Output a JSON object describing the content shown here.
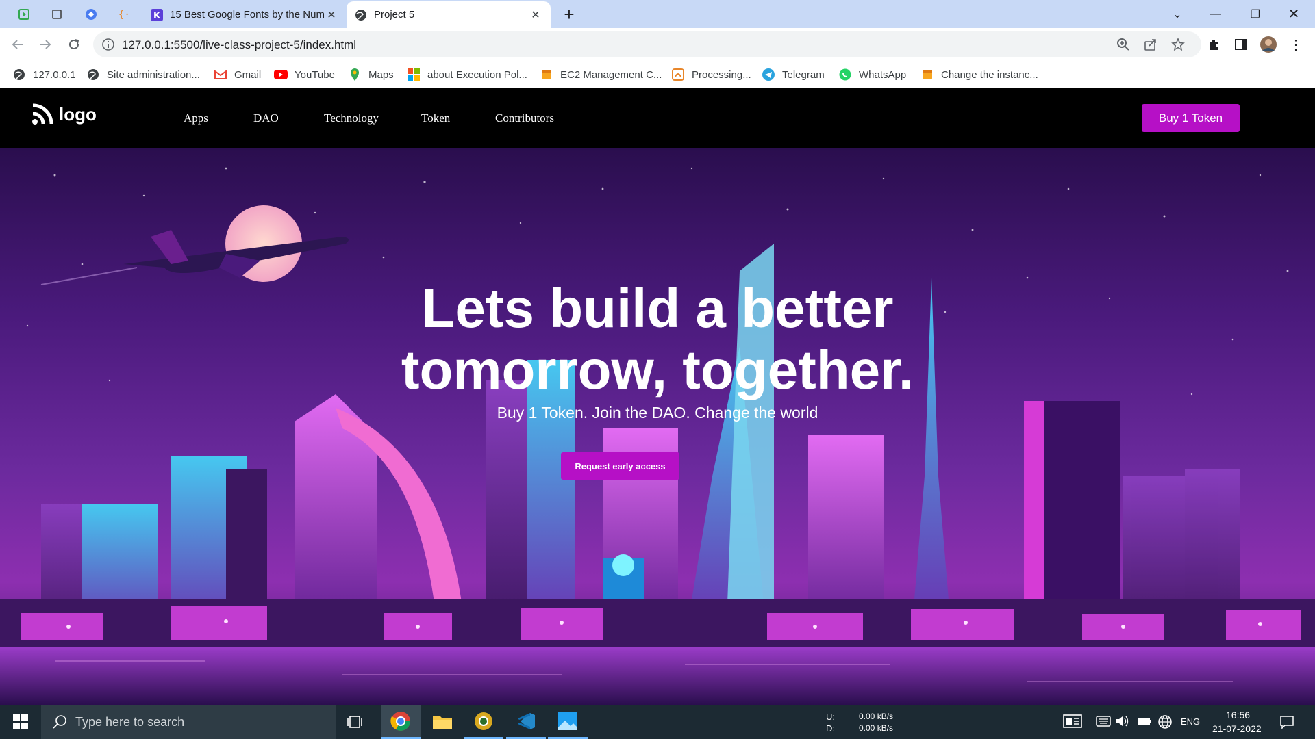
{
  "browser": {
    "tabs": [
      {
        "title": "15 Best Google Fonts by the Num",
        "favicon": "k-letter-icon",
        "active": false
      },
      {
        "title": "Project 5",
        "favicon": "globe-icon",
        "active": true
      }
    ],
    "new_tab": "+",
    "url": "127.0.0.1:5500/live-class-project-5/index.html",
    "bookmarks": [
      {
        "label": "127.0.0.1",
        "icon": "globe-icon"
      },
      {
        "label": "Site administration...",
        "icon": "globe-icon"
      },
      {
        "label": "Gmail",
        "icon": "gmail-icon"
      },
      {
        "label": "YouTube",
        "icon": "youtube-icon"
      },
      {
        "label": "Maps",
        "icon": "maps-icon"
      },
      {
        "label": "about Execution Pol...",
        "icon": "microsoft-icon"
      },
      {
        "label": "EC2 Management C...",
        "icon": "aws-icon"
      },
      {
        "label": "Processing...",
        "icon": "processing-icon"
      },
      {
        "label": "Telegram",
        "icon": "telegram-icon"
      },
      {
        "label": "WhatsApp",
        "icon": "whatsapp-icon"
      },
      {
        "label": "Change the instanc...",
        "icon": "aws-icon"
      }
    ]
  },
  "site": {
    "logo_text": "logo",
    "nav": [
      "Apps",
      "DAO",
      "Technology",
      "Token",
      "Contributors"
    ],
    "buy_button": "Buy 1 Token",
    "hero": {
      "title": "Lets build a better tomorrow, together.",
      "subtitle": "Buy 1 Token. Join the DAO. Change the world",
      "cta": "Request early access"
    },
    "accent_color": "#b610c6"
  },
  "taskbar": {
    "search_placeholder": "Type here to search",
    "net_up_label": "U:",
    "net_up": "0.00 kB/s",
    "net_down_label": "D:",
    "net_down": "0.00 kB/s",
    "lang": "ENG",
    "time": "16:56",
    "date": "21-07-2022"
  }
}
